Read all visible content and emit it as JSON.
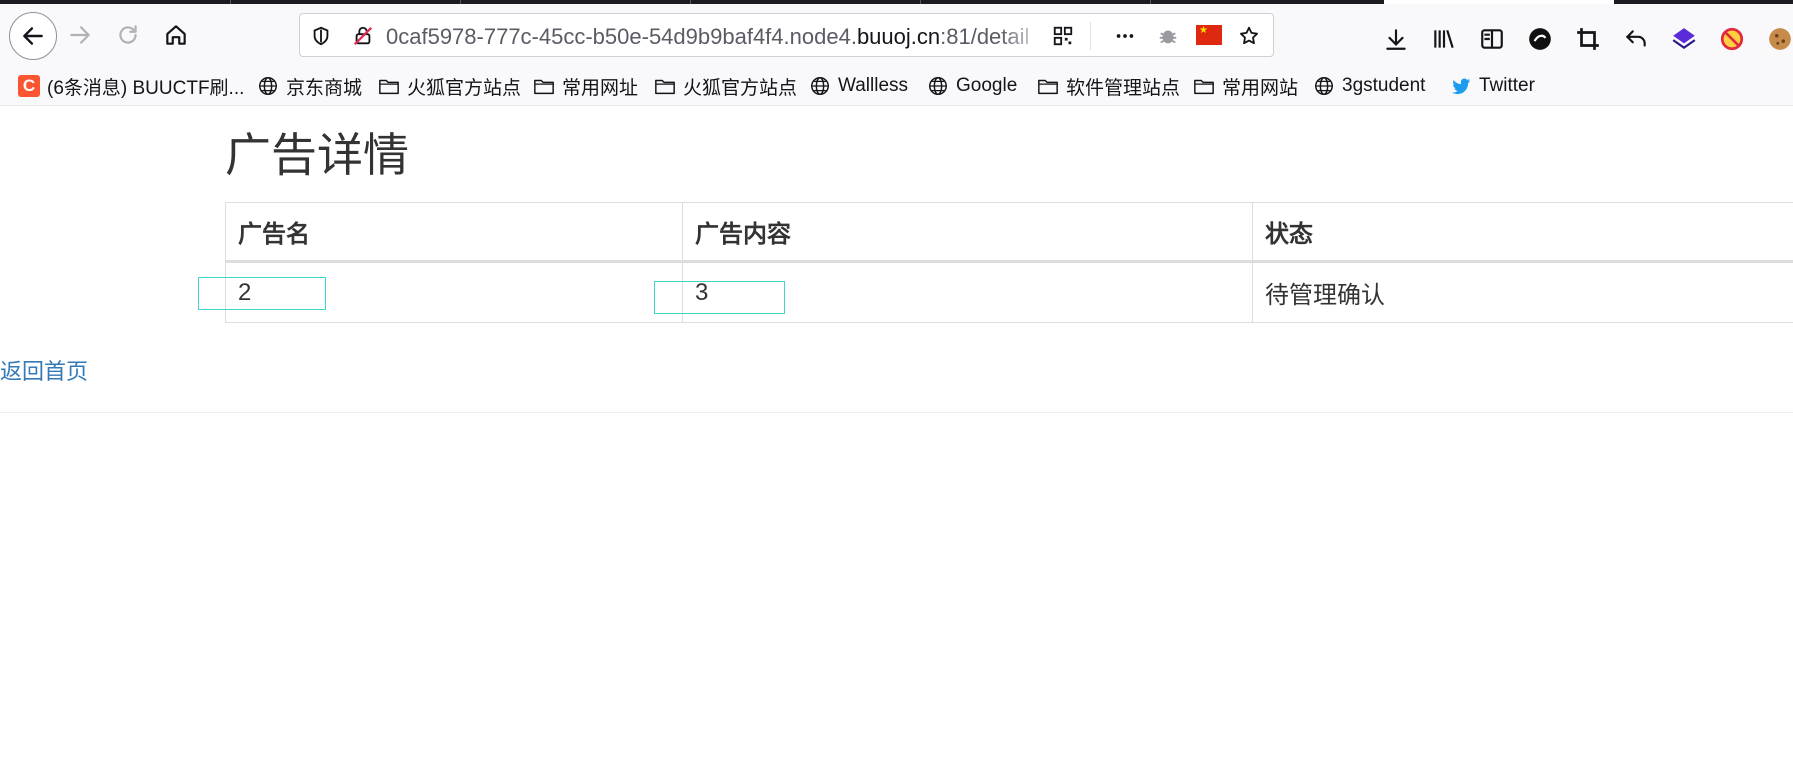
{
  "browser": {
    "url_prefix": "0caf5978-777c-45cc-b50e-54d9b9baf4f4.node4.",
    "url_host": "buuoj.cn",
    "url_suffix": ":81/detail"
  },
  "bookmarks": [
    {
      "label": "(6条消息) BUUCTF刷...",
      "icon": "csdn-icon"
    },
    {
      "label": "京东商城",
      "icon": "globe-icon"
    },
    {
      "label": "火狐官方站点",
      "icon": "folder-icon"
    },
    {
      "label": "常用网址",
      "icon": "folder-icon"
    },
    {
      "label": "火狐官方站点",
      "icon": "folder-icon"
    },
    {
      "label": "Wallless",
      "icon": "globe-icon"
    },
    {
      "label": "Google",
      "icon": "globe-icon"
    },
    {
      "label": "软件管理站点",
      "icon": "folder-icon"
    },
    {
      "label": "常用网站",
      "icon": "folder-icon"
    },
    {
      "label": "3gstudent",
      "icon": "globe-icon"
    },
    {
      "label": "Twitter",
      "icon": "twitter-icon"
    }
  ],
  "page": {
    "title": "广告详情",
    "table": {
      "headers": [
        "广告名",
        "广告内容",
        "状态"
      ],
      "rows": [
        [
          "2",
          "3",
          "待管理确认"
        ]
      ]
    },
    "home_link": "返回首页"
  },
  "colors": {
    "link": "#337ab7",
    "selection_outline": "#40d6d0",
    "csdn_brand": "#fc5531",
    "twitter_brand": "#1d9bf0"
  }
}
